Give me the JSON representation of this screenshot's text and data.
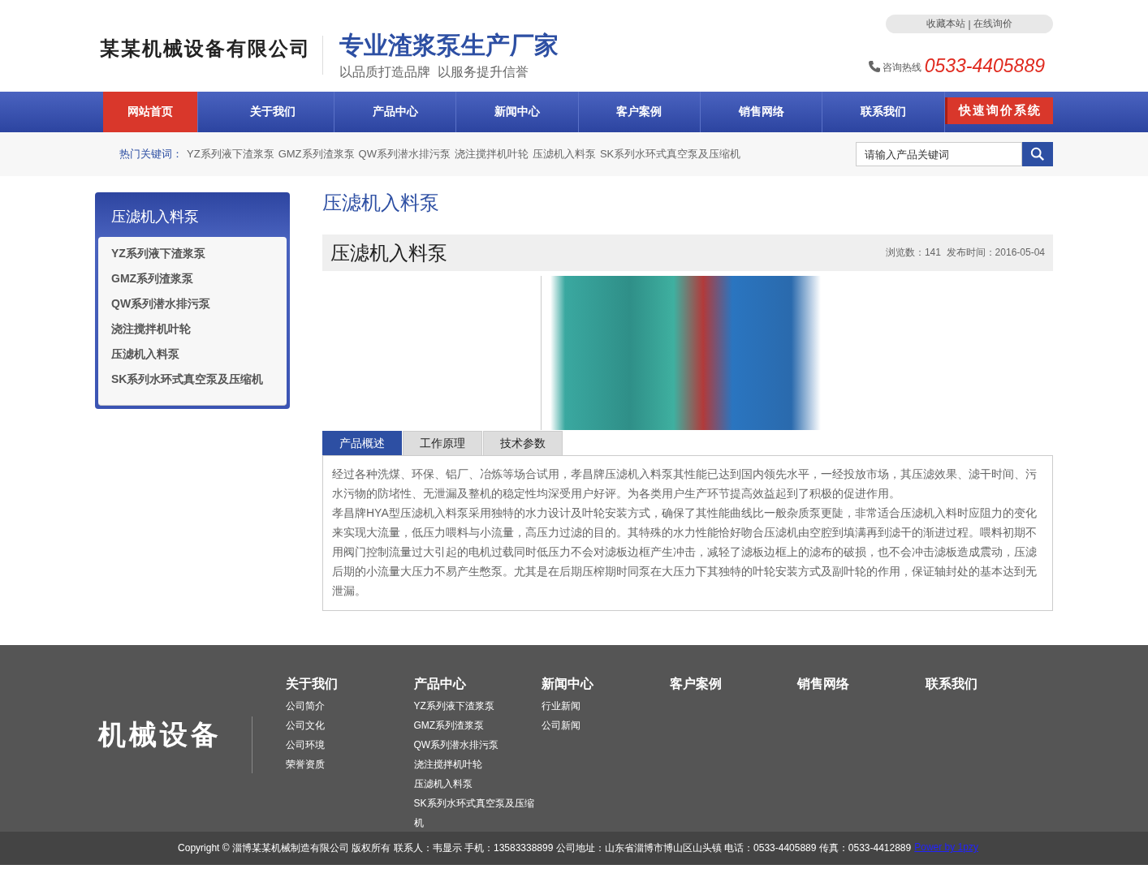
{
  "header": {
    "company_logo": "某某机械设备有限公司",
    "slogan": "专业渣浆泵生产厂家",
    "subslogan": "以品质打造品牌  以服务提升信誉",
    "top_links": [
      "收藏本站",
      "|",
      "在线询价"
    ],
    "hotline_label": "咨询热线",
    "hotline": "0533-4405889"
  },
  "nav": {
    "items": [
      {
        "label": "网站首页",
        "selected": true
      },
      {
        "label": "关于我们",
        "selected": false
      },
      {
        "label": "产品中心",
        "selected": false
      },
      {
        "label": "新闻中心",
        "selected": false
      },
      {
        "label": "客户案例",
        "selected": false
      },
      {
        "label": "销售网络",
        "selected": false
      },
      {
        "label": "联系我们",
        "selected": false
      }
    ],
    "quote_button": "快速询价系统"
  },
  "keywords": {
    "label": "热门关键词：",
    "items": [
      "YZ系列液下渣浆泵",
      "GMZ系列渣浆泵",
      "QW系列潜水排污泵",
      "浇注搅拌机叶轮",
      "压滤机入料泵",
      "SK系列水环式真空泵及压缩机"
    ]
  },
  "search": {
    "placeholder": "请输入产品关键词"
  },
  "sidebar": {
    "title": "压滤机入料泵",
    "items": [
      "YZ系列液下渣浆泵",
      "GMZ系列渣浆泵",
      "QW系列潜水排污泵",
      "浇注搅拌机叶轮",
      "压滤机入料泵",
      "SK系列水环式真空泵及压缩机"
    ]
  },
  "content": {
    "section_title": "压滤机入料泵",
    "product_title": "压滤机入料泵",
    "meta": "浏览数：141  发布时间：2016-05-04",
    "tabs": [
      {
        "label": "产品概述",
        "selected": true
      },
      {
        "label": "工作原理",
        "selected": false
      },
      {
        "label": "技术参数",
        "selected": false
      }
    ],
    "paragraphs": [
      "经过各种洗煤、环保、铝厂、冶炼等场合试用，孝昌牌压滤机入料泵其性能已达到国内领先水平，一经投放市场，其压滤效果、滤干时间、污水污物的防堵性、无泄漏及整机的稳定性均深受用户好评。为各类用户生产环节提高效益起到了积极的促进作用。",
      "孝昌牌HYA型压滤机入料泵采用独特的水力设计及叶轮安装方式，确保了其性能曲线比一般杂质泵更陡，非常适合压滤机入料时应阻力的变化来实现大流量，低压力喂料与小流量，高压力过滤的目的。其特殊的水力性能恰好吻合压滤机由空腔到填满再到滤干的渐进过程。喂料初期不用阀门控制流量过大引起的电机过载同时低压力不会对滤板边框产生冲击，减轻了滤板边框上的滤布的破损，也不会冲击滤板造成震动，压滤后期的小流量大压力不易产生憋泵。尤其是在后期压榨期时同泵在大压力下其独特的叶轮安装方式及副叶轮的作用，保证轴封处的基本达到无泄漏。"
    ]
  },
  "footer": {
    "logo": "机械设备",
    "columns": [
      {
        "title": "关于我们",
        "links": [
          "公司简介",
          "公司文化",
          "公司环境",
          "荣誉资质"
        ]
      },
      {
        "title": "产品中心",
        "links": [
          "YZ系列液下渣浆泵",
          "GMZ系列渣浆泵",
          "QW系列潜水排污泵",
          "浇注搅拌机叶轮",
          "压滤机入料泵",
          "SK系列水环式真空泵及压缩机"
        ]
      },
      {
        "title": "新闻中心",
        "links": [
          "行业新闻",
          "公司新闻"
        ]
      },
      {
        "title": "客户案例"
      },
      {
        "title": "销售网络"
      },
      {
        "title": "联系我们"
      }
    ],
    "copyright": "Copyright © 淄博某某机械制造有限公司 版权所有 联系人：韦显示 手机：13583338899 公司地址：山东省淄博市博山区山头镇 电话：0533-4405889 传真：0533-4412889",
    "power_link": "Power by 1pzy"
  }
}
